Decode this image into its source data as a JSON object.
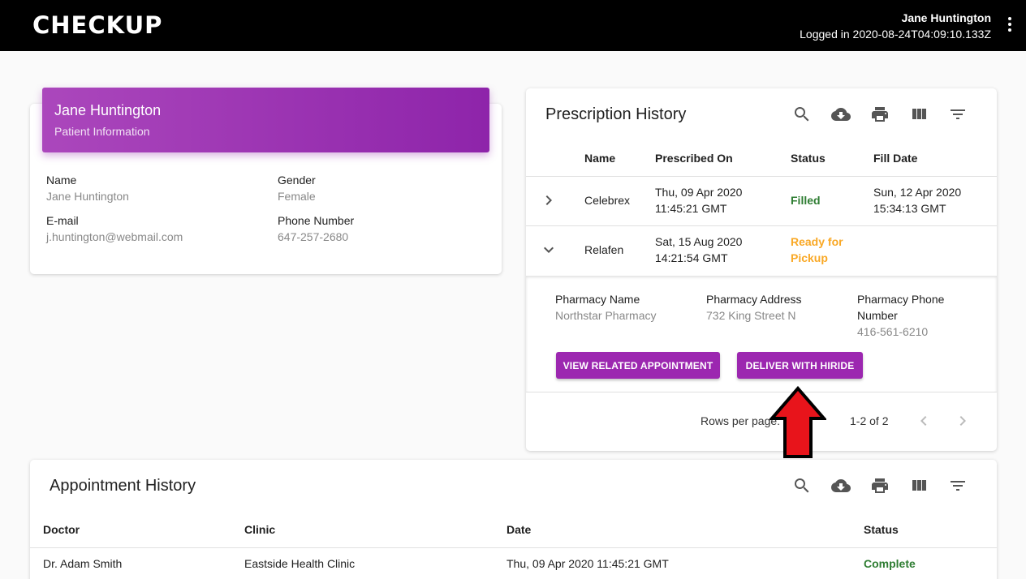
{
  "header": {
    "logo": "CHECKUP",
    "user_name": "Jane Huntington",
    "login_status": "Logged in 2020-08-24T04:09:10.133Z"
  },
  "patient": {
    "name_title": "Jane Huntington",
    "subtitle": "Patient Information",
    "fields": {
      "name_label": "Name",
      "name_value": "Jane Huntington",
      "gender_label": "Gender",
      "gender_value": "Female",
      "email_label": "E-mail",
      "email_value": "j.huntington@webmail.com",
      "phone_label": "Phone Number",
      "phone_value": "647-257-2680"
    }
  },
  "prescriptions": {
    "title": "Prescription History",
    "columns": [
      "Name",
      "Prescribed On",
      "Status",
      "Fill Date"
    ],
    "rows": [
      {
        "name": "Celebrex",
        "prescribed_date": "Thu, 09 Apr 2020",
        "prescribed_time": "11:45:21 GMT",
        "status_l1": "Filled",
        "status_l2": "",
        "fill_date": "Sun, 12 Apr 2020",
        "fill_time": "15:34:13 GMT"
      },
      {
        "name": "Relafen",
        "prescribed_date": "Sat, 15 Aug 2020",
        "prescribed_time": "14:21:54 GMT",
        "status_l1": "Ready for",
        "status_l2": "Pickup",
        "fill_date": "",
        "fill_time": ""
      }
    ],
    "detail": {
      "pharmacy_name_label": "Pharmacy Name",
      "pharmacy_name_value": "Northstar Pharmacy",
      "pharmacy_address_label": "Pharmacy Address",
      "pharmacy_address_value": "732 King Street N",
      "pharmacy_phone_label_l1": "Pharmacy Phone",
      "pharmacy_phone_label_l2": "Number",
      "pharmacy_phone_value": "416-561-6210",
      "view_button": "VIEW RELATED APPOINTMENT",
      "deliver_button": "DELIVER WITH HIRIDE"
    },
    "pagination": {
      "rows_per_page": "Rows per page:",
      "range": "1-2 of 2"
    }
  },
  "appointments": {
    "title": "Appointment History",
    "columns": [
      "Doctor",
      "Clinic",
      "Date",
      "Status"
    ],
    "rows": [
      {
        "doctor": "Dr. Adam Smith",
        "clinic": "Eastside Health Clinic",
        "date": "Thu, 09 Apr 2020 11:45:21 GMT",
        "status": "Complete"
      }
    ]
  },
  "icons": [
    "search-icon",
    "cloud-download-icon",
    "print-icon",
    "view-column-icon",
    "filter-list-icon",
    "chevron-right-icon",
    "chevron-down-icon",
    "chevron-left-icon",
    "more-vert-icon",
    "red-arrow-icon"
  ],
  "colors": {
    "accent": "#9c27b0",
    "filled": "#2e7d32",
    "ready": "#f9a825",
    "arrow": "#e8141b"
  }
}
